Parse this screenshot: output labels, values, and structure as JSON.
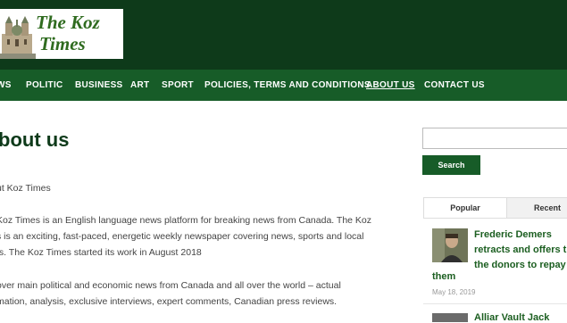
{
  "site": {
    "logo_line1": "The Koz",
    "logo_line2": "Times"
  },
  "nav": {
    "items": [
      {
        "label": "WS"
      },
      {
        "label": "POLITIC"
      },
      {
        "label": "BUSINESS"
      },
      {
        "label": "ART"
      },
      {
        "label": "SPORT"
      },
      {
        "label": "POLICIES, TERMS AND CONDITIONS"
      },
      {
        "label": "ABOUT US",
        "active": true
      },
      {
        "label": "CONTACT US"
      }
    ]
  },
  "main": {
    "title": "bout us",
    "paragraphs": [
      "ut Koz Times",
      "Koz Times is an English language news platform for breaking news from Canada. The Koz",
      "s is an exciting, fast-paced, energetic weekly newspaper covering news, sports and local",
      "ts. The Koz Times started its work in August 2018",
      "over main political and economic news from Canada and all over the world – actual",
      "mation, analysis, exclusive interviews, expert comments, Canadian press reviews."
    ]
  },
  "sidebar": {
    "search_placeholder": "",
    "search_button": "Search",
    "tabs": [
      "Popular",
      "Recent"
    ],
    "articles": [
      {
        "title": "Frederic Demers retracts and offers t the donors to repay",
        "title_tail": "them",
        "date": "May 18, 2019"
      },
      {
        "title": "Alliar Vault Jack"
      }
    ]
  },
  "colors": {
    "header_bg": "#0e3a1a",
    "nav_bg": "#175c28",
    "accent": "#1b5e20"
  }
}
